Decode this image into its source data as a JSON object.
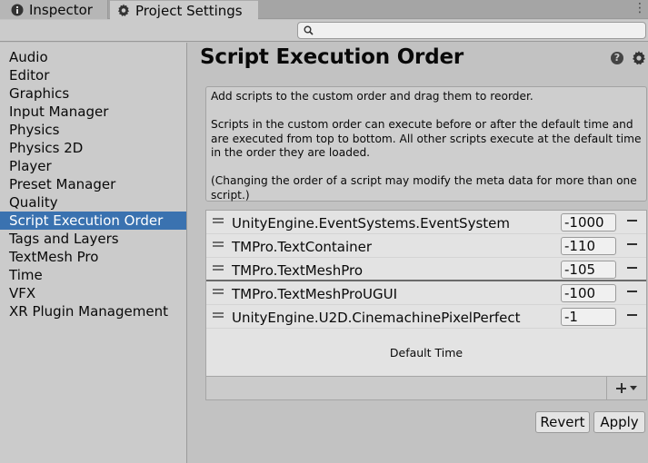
{
  "tabs": [
    {
      "label": "Inspector",
      "icon": "info-icon"
    },
    {
      "label": "Project Settings",
      "icon": "gear-icon"
    }
  ],
  "search": {
    "value": "",
    "placeholder": ""
  },
  "sidebar": {
    "items": [
      {
        "label": "Audio"
      },
      {
        "label": "Editor"
      },
      {
        "label": "Graphics"
      },
      {
        "label": "Input Manager"
      },
      {
        "label": "Physics"
      },
      {
        "label": "Physics 2D"
      },
      {
        "label": "Player"
      },
      {
        "label": "Preset Manager"
      },
      {
        "label": "Quality"
      },
      {
        "label": "Script Execution Order"
      },
      {
        "label": "Tags and Layers"
      },
      {
        "label": "TextMesh Pro"
      },
      {
        "label": "Time"
      },
      {
        "label": "VFX"
      },
      {
        "label": "XR Plugin Management"
      }
    ],
    "selected": "Script Execution Order",
    "selected_color": "#3a72b0"
  },
  "main": {
    "title": "Script Execution Order",
    "info": [
      "Add scripts to the custom order and drag them to reorder.",
      "Scripts in the custom order can execute before or after the default time and are executed from top to bottom. All other scripts execute at the default time in the order they are loaded.",
      "(Changing the order of a script may modify the meta data for more than one script.)"
    ],
    "scripts": [
      {
        "name": "UnityEngine.EventSystems.EventSystem",
        "order": "-1000"
      },
      {
        "name": "TMPro.TextContainer",
        "order": "-110"
      },
      {
        "name": "TMPro.TextMeshPro",
        "order": "-105"
      },
      {
        "name": "TMPro.TextMeshProUGUI",
        "order": "-100"
      },
      {
        "name": "UnityEngine.U2D.CinemachinePixelPerfect",
        "order": "-1"
      }
    ],
    "default_time_label": "Default Time",
    "revert_label": "Revert",
    "apply_label": "Apply"
  }
}
